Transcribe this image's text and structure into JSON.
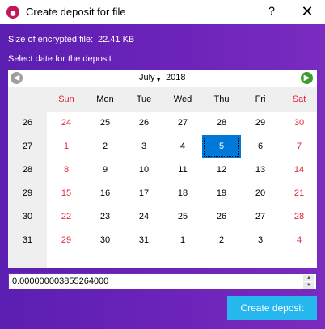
{
  "window": {
    "title": "Create deposit for file",
    "help_label": "?",
    "close_label": "✕",
    "icon": "app-logo-icon"
  },
  "file": {
    "size_label": "Size of encrypted file:",
    "size_value": "22.41 KB"
  },
  "deposit": {
    "select_label": "Select date for the deposit"
  },
  "calendar": {
    "month": "July",
    "year": "2018",
    "prev_icon": "arrow-left-icon",
    "next_icon": "arrow-right-icon",
    "weekdays": [
      "Sun",
      "Mon",
      "Tue",
      "Wed",
      "Thu",
      "Fri",
      "Sat"
    ],
    "weeks": [
      {
        "num": "26",
        "days": [
          "24",
          "25",
          "26",
          "27",
          "28",
          "29",
          "30"
        ]
      },
      {
        "num": "27",
        "days": [
          "1",
          "2",
          "3",
          "4",
          "5",
          "6",
          "7"
        ]
      },
      {
        "num": "28",
        "days": [
          "8",
          "9",
          "10",
          "11",
          "12",
          "13",
          "14"
        ]
      },
      {
        "num": "29",
        "days": [
          "15",
          "16",
          "17",
          "18",
          "19",
          "20",
          "21"
        ]
      },
      {
        "num": "30",
        "days": [
          "22",
          "23",
          "24",
          "25",
          "26",
          "27",
          "28"
        ]
      },
      {
        "num": "31",
        "days": [
          "29",
          "30",
          "31",
          "1",
          "2",
          "3",
          "4"
        ]
      }
    ],
    "selected_day": "5",
    "colors": {
      "weekend": "#e0263a",
      "selected_bg": "#0078d7"
    }
  },
  "amount": {
    "value": "0.000000003855264000"
  },
  "actions": {
    "create_label": "Create deposit"
  },
  "theme": {
    "background_start": "#5b1fb1",
    "background_end": "#7a2bc0",
    "button_color": "#26b7ef"
  }
}
